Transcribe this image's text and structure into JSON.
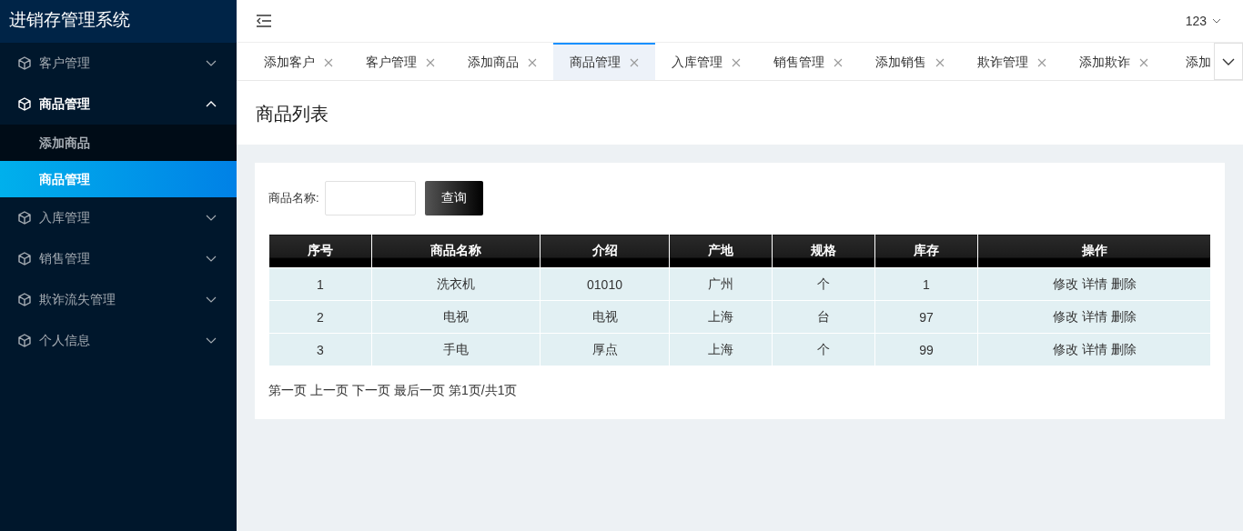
{
  "app_title": "进销存管理系统",
  "sidebar": {
    "items": [
      {
        "label": "客户管理",
        "expanded": false
      },
      {
        "label": "商品管理",
        "expanded": true,
        "children": [
          {
            "label": "添加商品",
            "selected": false
          },
          {
            "label": "商品管理",
            "selected": true
          }
        ]
      },
      {
        "label": "入库管理",
        "expanded": false
      },
      {
        "label": "销售管理",
        "expanded": false
      },
      {
        "label": "欺诈流失管理",
        "expanded": false
      },
      {
        "label": "个人信息",
        "expanded": false
      }
    ]
  },
  "user": "123",
  "tabs": [
    {
      "label": "添加客户",
      "selected": false,
      "closable": true
    },
    {
      "label": "客户管理",
      "selected": false,
      "closable": true
    },
    {
      "label": "添加商品",
      "selected": false,
      "closable": true
    },
    {
      "label": "商品管理",
      "selected": true,
      "closable": true
    },
    {
      "label": "入库管理",
      "selected": false,
      "closable": true
    },
    {
      "label": "销售管理",
      "selected": false,
      "closable": true
    },
    {
      "label": "添加销售",
      "selected": false,
      "closable": true
    },
    {
      "label": "欺诈管理",
      "selected": false,
      "closable": true
    },
    {
      "label": "添加欺诈",
      "selected": false,
      "closable": true
    },
    {
      "label": "添加",
      "selected": false,
      "closable": false
    }
  ],
  "page_title": "商品列表",
  "search": {
    "label": "商品名称:",
    "button": "查询"
  },
  "table": {
    "columns": [
      "序号",
      "商品名称",
      "介绍",
      "产地",
      "规格",
      "库存",
      "操作"
    ],
    "rows": [
      {
        "cells": [
          "1",
          "洗衣机",
          "01010",
          "广州",
          "个",
          "1"
        ],
        "actions": [
          "修改",
          "详情",
          "删除"
        ]
      },
      {
        "cells": [
          "2",
          "电视",
          "电视",
          "上海",
          "台",
          "97"
        ],
        "actions": [
          "修改",
          "详情",
          "删除"
        ]
      },
      {
        "cells": [
          "3",
          "手电",
          "厚点",
          "上海",
          "个",
          "99"
        ],
        "actions": [
          "修改",
          "详情",
          "删除"
        ]
      }
    ]
  },
  "pagination": {
    "links": [
      "第一页",
      "上一页",
      "下一页",
      "最后一页"
    ],
    "status": "第1页/共1页"
  }
}
